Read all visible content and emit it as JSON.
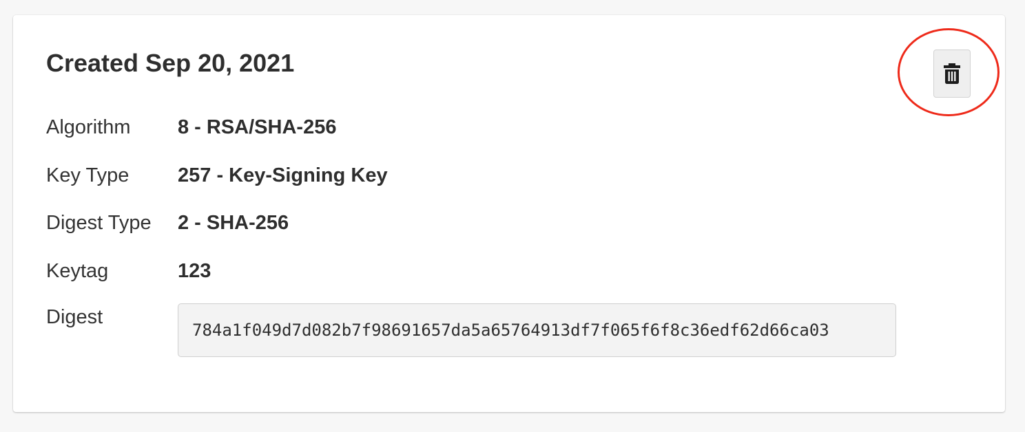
{
  "card": {
    "title": "Created Sep 20, 2021",
    "delete_button": {
      "icon": "trash-icon",
      "highlight_color": "#ee2a1a"
    },
    "rows": [
      {
        "label": "Algorithm",
        "value": "8 - RSA/SHA-256"
      },
      {
        "label": "Key Type",
        "value": "257 - Key-Signing Key"
      },
      {
        "label": "Digest Type",
        "value": "2 - SHA-256"
      },
      {
        "label": "Keytag",
        "value": "123"
      }
    ],
    "digest": {
      "label": "Digest",
      "value": "784a1f049d7d082b7f98691657da5a65764913df7f065f6f8c36edf62d66ca03"
    }
  }
}
